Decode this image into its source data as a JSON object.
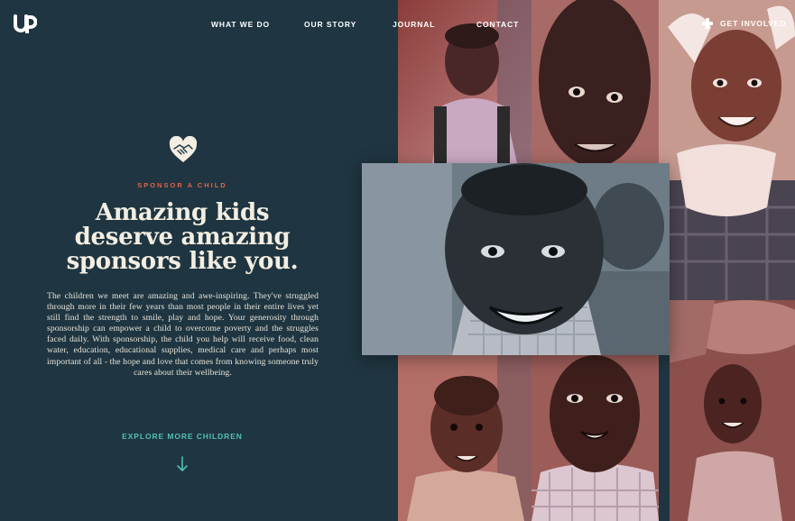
{
  "brand": {
    "logo_text": "UP",
    "logo_icon": "up-logo-icon"
  },
  "nav": {
    "items": [
      {
        "label": "WHAT WE DO"
      },
      {
        "label": "OUR STORY"
      },
      {
        "label": "JOURNAL"
      },
      {
        "label": "CONTACT"
      }
    ],
    "cta": {
      "label": "GET INVOLVED",
      "icon": "plus-icon"
    }
  },
  "hero": {
    "icon": "heart-handshake-icon",
    "kicker": "SPONSOR A CHILD",
    "headline": [
      "Amazing kids",
      "deserve amazing",
      "sponsors like you."
    ],
    "body": "The children we meet are amazing and awe-inspiring. They've struggled through more in their few years than most people in their entire lives yet still find the strength to smile, play and hope. Your generosity through sponsorship can empower a child to overcome poverty and the struggles faced daily. With sponsorship, the child you help will receive food, clean water, education, educational supplies, medical care and perhaps most important of all - the hope and love that comes from knowing someone truly cares about their wellbeing.",
    "explore_label": "EXPLORE MORE CHILDREN",
    "explore_icon": "arrow-down-icon"
  },
  "colors": {
    "background": "#1f3541",
    "accent_coral": "#e2634a",
    "accent_teal": "#4fc1b4",
    "headline": "#f3eee2",
    "photo_tint": "#c98b8b"
  }
}
